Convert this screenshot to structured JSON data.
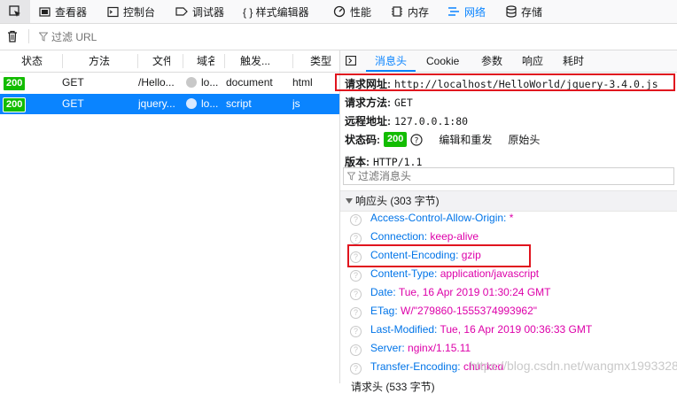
{
  "toolbar": {
    "items": [
      {
        "label": "查看器",
        "icon": "inspector-icon"
      },
      {
        "label": "控制台",
        "icon": "console-icon"
      },
      {
        "label": "调试器",
        "icon": "debugger-icon"
      },
      {
        "label": "{ } 样式编辑器",
        "icon": "style-editor-icon"
      },
      {
        "label": "性能",
        "icon": "performance-icon"
      },
      {
        "label": "内存",
        "icon": "memory-icon"
      },
      {
        "label": "网络",
        "icon": "network-icon"
      },
      {
        "label": "存储",
        "icon": "storage-icon"
      }
    ],
    "accent": "#0a84ff"
  },
  "filter": {
    "placeholder": "过滤 URL"
  },
  "list": {
    "columns": [
      "状态",
      "方法",
      "文件",
      "域名",
      "触发...",
      "类型"
    ],
    "rows": [
      {
        "status": "200",
        "method": "GET",
        "file": "/Hello...",
        "domain": "lo...",
        "cause": "document",
        "type": "html",
        "selected": false
      },
      {
        "status": "200",
        "method": "GET",
        "file": "jquery...",
        "domain": "lo...",
        "cause": "script",
        "type": "js",
        "selected": true
      }
    ]
  },
  "details": {
    "tabs": [
      "消息头",
      "Cookie",
      "参数",
      "响应",
      "耗时"
    ],
    "request_url_label": "请求网址:",
    "request_url": "http://localhost/HelloWorld/jquery-3.4.0.js",
    "method_label": "请求方法:",
    "method": "GET",
    "remote_label": "远程地址:",
    "remote": "127.0.0.1:80",
    "status_label": "状态码:",
    "status": "200",
    "edit_resend": "编辑和重发",
    "raw_headers": "原始头",
    "version_label": "版本:",
    "version": "HTTP/1.1",
    "header_filter_placeholder": "过滤消息头",
    "response_section": "响应头 (303 字节)",
    "response_headers": [
      {
        "name": "Access-Control-Allow-Origin:",
        "value": "*"
      },
      {
        "name": "Connection:",
        "value": "keep-alive"
      },
      {
        "name": "Content-Encoding:",
        "value": "gzip"
      },
      {
        "name": "Content-Type:",
        "value": "application/javascript"
      },
      {
        "name": "Date:",
        "value": "Tue, 16 Apr 2019 01:30:24 GMT"
      },
      {
        "name": "ETag:",
        "value": "W/\"279860-1555374993962\""
      },
      {
        "name": "Last-Modified:",
        "value": "Tue, 16 Apr 2019 00:36:33 GMT"
      },
      {
        "name": "Server:",
        "value": "nginx/1.15.11"
      },
      {
        "name": "Transfer-Encoding:",
        "value": "chunked"
      }
    ],
    "next_section_partial": "请求头 (533 字节)"
  },
  "watermark": "https://blog.csdn.net/wangmx1993328"
}
